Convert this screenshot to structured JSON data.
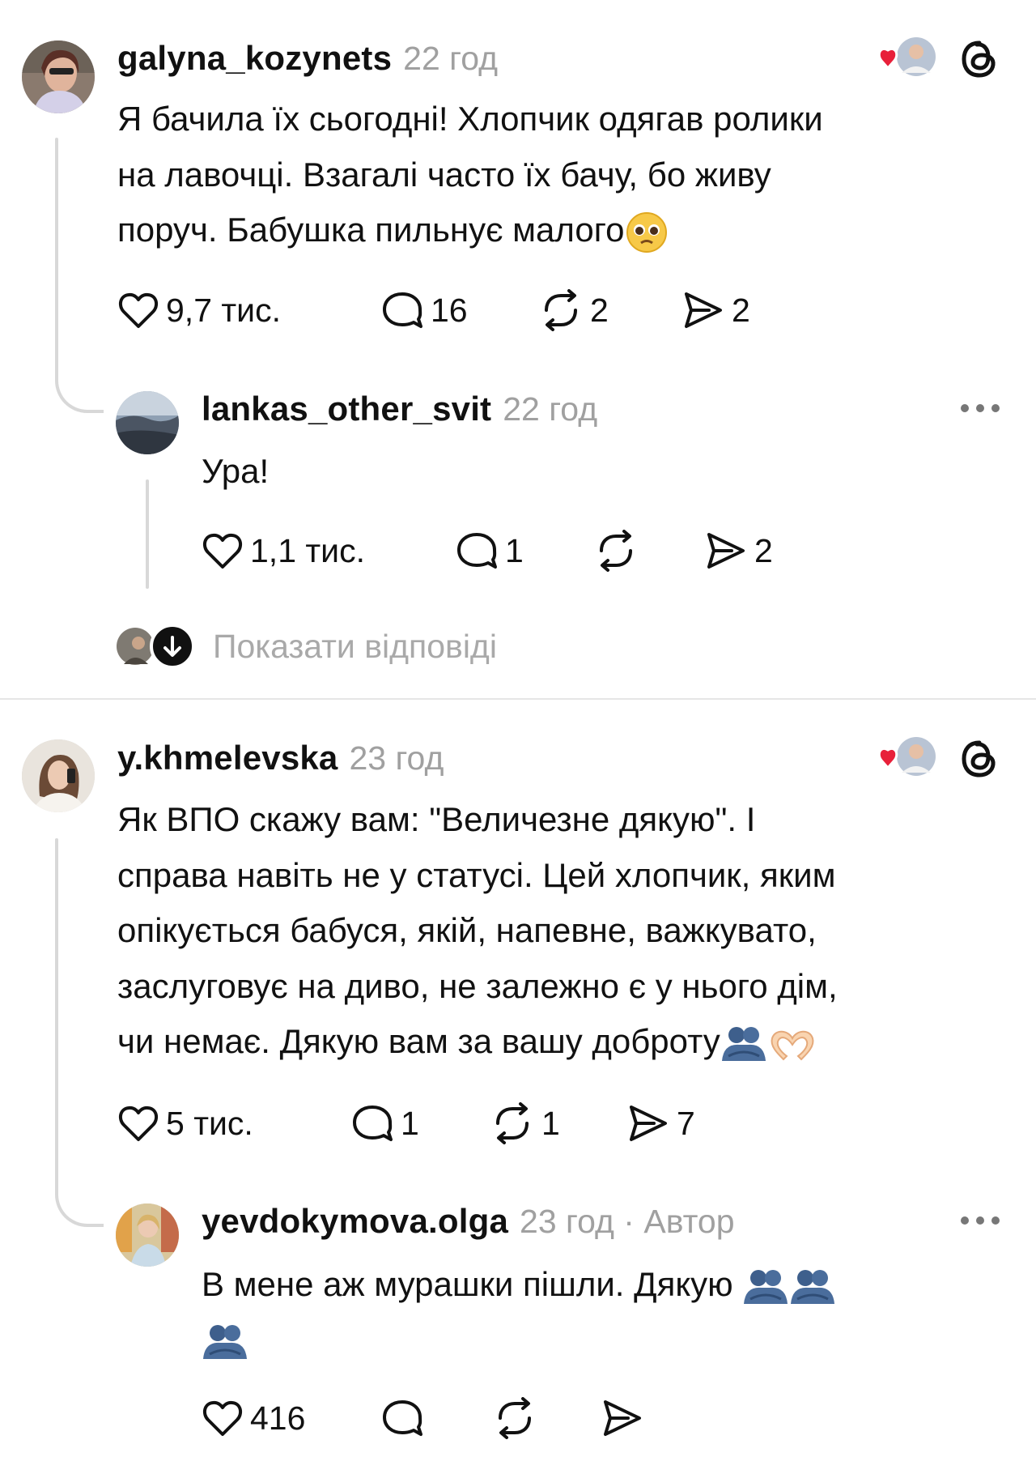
{
  "threads": [
    {
      "comment": {
        "username": "galyna_kozynets",
        "time": "22 год",
        "text": "Я бачила їх сьогодні! Хлопчик одягав ролики\nна лавочці. Взагалі часто їх бачу, бо живу\nпоруч. Бабушка пильнує малого",
        "emoji_end": "pleading-face",
        "likes": "9,7 тис.",
        "replies": "16",
        "reposts": "2",
        "shares": "2"
      },
      "reply": {
        "username": "lankas_other_svit",
        "time": "22 год",
        "text": "Ура!",
        "likes": "1,1 тис.",
        "replies": "1",
        "reposts": "",
        "shares": "2"
      },
      "show_replies_label": "Показати відповіді"
    },
    {
      "comment": {
        "username": "y.khmelevska",
        "time": "23 год",
        "text": "Як ВПО скажу вам: \"Величезне дякую\". І\nсправа навіть не у статусі. Цей хлопчик, яким\nопікується бабуся, якій, напевне, важкувато,\nзаслуговує на диво, не залежно є у нього дім,\nчи немає. Дякую вам за вашу доброту",
        "emoji_end": "hugging-people heart-hands",
        "likes": "5 тис.",
        "replies": "1",
        "reposts": "1",
        "shares": "7"
      },
      "reply": {
        "username": "yevdokymova.olga",
        "time": "23 год · Автор",
        "text": "В мене аж мурашки пішли. Дякую",
        "emoji_end": "hugging-people hugging-people hugging-people",
        "likes": "416",
        "replies": "",
        "reposts": "",
        "shares": ""
      }
    }
  ],
  "icons": {
    "like": "heart-outline-icon",
    "reply": "speech-bubble-icon",
    "repost": "repost-arrows-icon",
    "share": "send-icon",
    "threads": "threads-logo-icon",
    "liked_by_author": "heart-with-avatar-icon",
    "more": "more-dots-icon",
    "expand": "arrow-down-circle-icon"
  },
  "colors": {
    "text": "#111111",
    "muted": "#a0a0a0",
    "heart_red": "#e8203a",
    "divider": "#e6e6e6",
    "thread_line": "#d8d8d8"
  }
}
